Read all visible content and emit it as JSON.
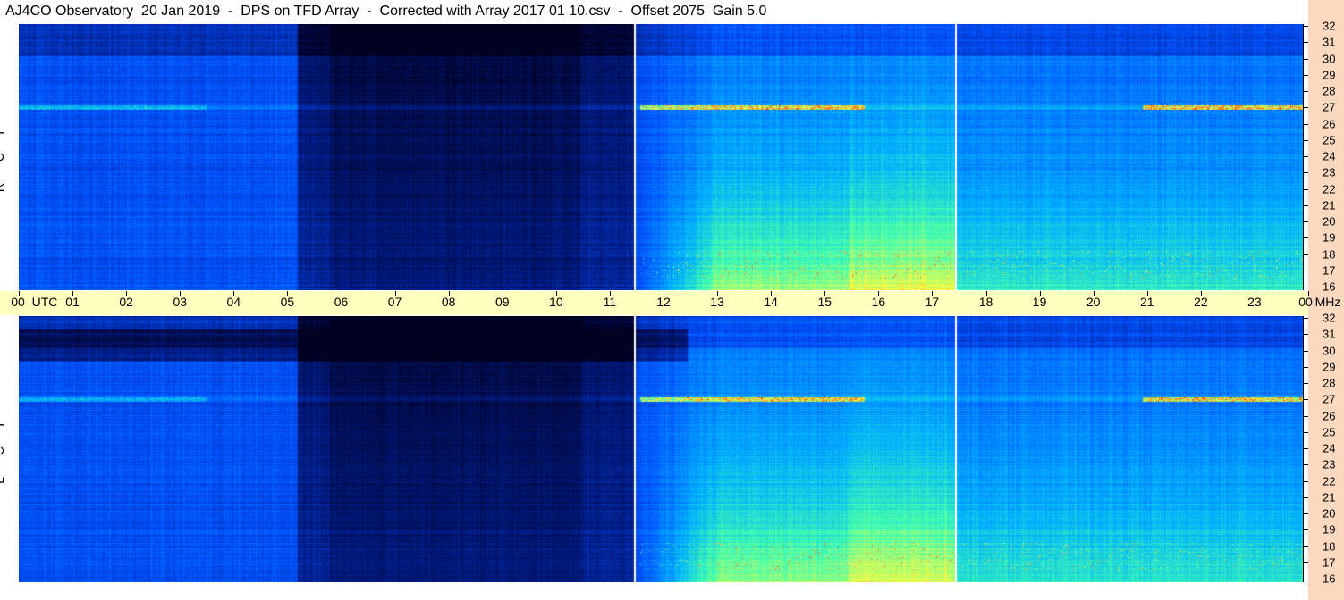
{
  "title": "AJ4CO Observatory  20 Jan 2019  -  DPS on TFD Array  -  Corrected with Array 2017 01 10.csv  -  Offset 2075  Gain 5.0",
  "panels": [
    {
      "label": "R C P",
      "letters": [
        "R",
        "C",
        "P"
      ]
    },
    {
      "label": "L C P",
      "letters": [
        "L",
        "C",
        "P"
      ]
    }
  ],
  "time_axis": {
    "unit_label": "UTC",
    "ticks": [
      "00",
      "01",
      "02",
      "03",
      "04",
      "05",
      "06",
      "07",
      "08",
      "09",
      "10",
      "11",
      "12",
      "13",
      "14",
      "15",
      "16",
      "17",
      "18",
      "19",
      "20",
      "21",
      "22",
      "23",
      "00"
    ],
    "end_unit": "MHz"
  },
  "freq_axis": {
    "ticks": [
      "32",
      "31",
      "30",
      "29",
      "28",
      "27",
      "26",
      "25",
      "24",
      "23",
      "22",
      "21",
      "20",
      "19",
      "18",
      "17",
      "16"
    ]
  },
  "colors": {
    "background": "#ffffff",
    "axis_band": "#ffffc0",
    "right_band": "#fbd8c0",
    "colormap": [
      "#000020",
      "#001a80",
      "#0050ff",
      "#00b0ff",
      "#40ffb0",
      "#ffff40",
      "#ff4000",
      "#ffffff"
    ]
  },
  "chart_data": {
    "type": "heatmap",
    "title": "AJ4CO Observatory  20 Jan 2019  -  DPS on TFD Array  -  Corrected with Array 2017 01 10.csv  -  Offset 2075  Gain 5.0",
    "xlabel": "UTC",
    "ylabel": "MHz",
    "xlim": [
      0,
      24
    ],
    "ylim": [
      16,
      32
    ],
    "series": [
      {
        "name": "R C P"
      },
      {
        "name": "L C P"
      }
    ],
    "markers_utc": [
      11.5,
      17.5
    ],
    "notable_features_mhz": [
      27,
      17.5
    ]
  }
}
